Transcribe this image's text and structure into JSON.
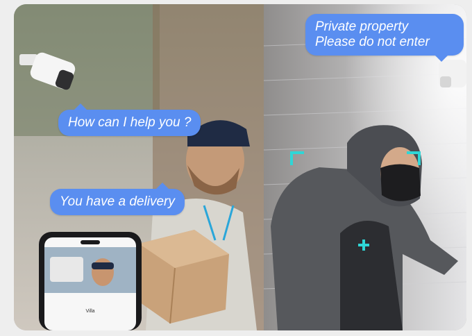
{
  "bubbles": {
    "assistant_question": "How can I help you ?",
    "delivery_notice": "You have a delivery",
    "warning_line1": "Private property",
    "warning_line2": "Please do not enter"
  },
  "phone": {
    "app_title": "Villa"
  },
  "colors": {
    "bubble": "#5a8ef0",
    "detection_box": "#2fd6d6"
  },
  "icons": [
    "security-camera-icon",
    "phone-device-icon"
  ]
}
